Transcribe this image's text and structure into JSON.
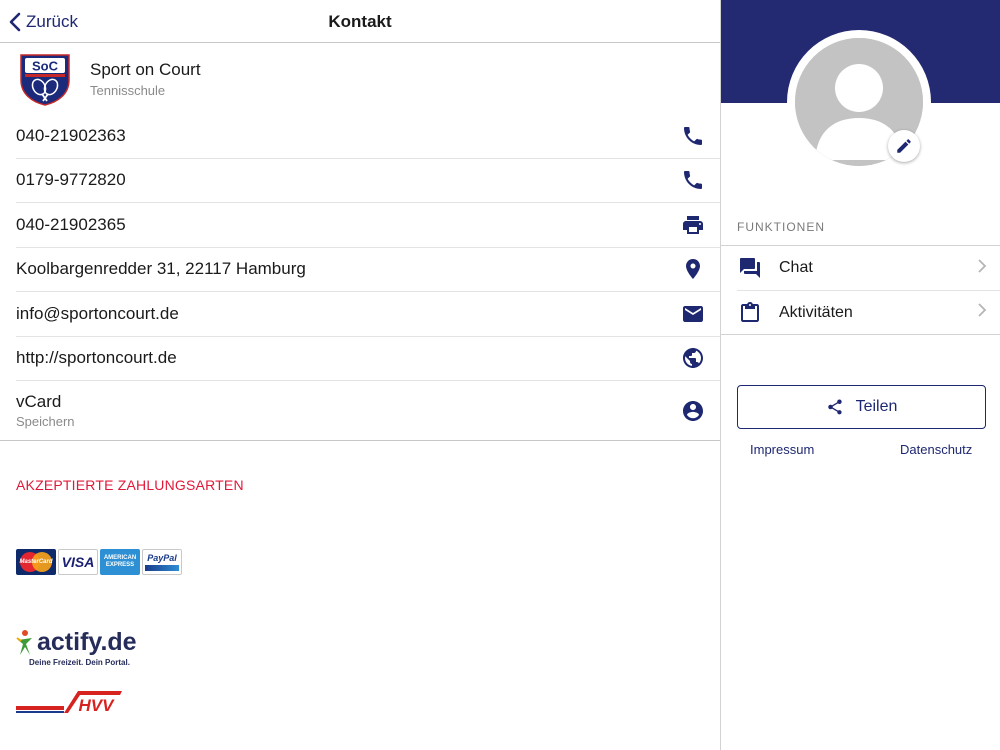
{
  "nav": {
    "back_label": "Zurück",
    "title": "Kontakt"
  },
  "organization": {
    "name": "Sport on Court",
    "subtitle": "Tennisschule",
    "logo_text": "SoC"
  },
  "contacts": [
    {
      "text": "040-21902363",
      "icon": "phone-icon"
    },
    {
      "text": "0179-9772820",
      "icon": "phone-icon"
    },
    {
      "text": "040-21902365",
      "icon": "printer-icon"
    },
    {
      "text": "Koolbargenredder 31, 22117 Hamburg",
      "icon": "location-pin-icon"
    },
    {
      "text": "info@sportoncourt.de",
      "icon": "envelope-icon"
    },
    {
      "text": "http://sportoncourt.de",
      "icon": "globe-icon"
    }
  ],
  "vcard": {
    "label": "vCard",
    "sublabel": "Speichern",
    "icon": "account-circle-icon"
  },
  "payment": {
    "heading": "AKZEPTIERTE ZAHLUNGSARTEN",
    "methods": [
      {
        "name": "MasterCard",
        "label": "MasterCard"
      },
      {
        "name": "Visa",
        "label": "VISA"
      },
      {
        "name": "American Express",
        "label_line1": "AMERICAN",
        "label_line2": "EXPRESS"
      },
      {
        "name": "PayPal",
        "label": "PayPal"
      }
    ]
  },
  "partners": {
    "actify": {
      "name": "actify.de",
      "tagline": "Deine Freizeit. Dein Portal."
    },
    "hvv": {
      "name": "HVV"
    }
  },
  "sidebar": {
    "functions_heading": "FUNKTIONEN",
    "functions": [
      {
        "label": "Chat",
        "icon": "chat-icon"
      },
      {
        "label": "Aktivitäten",
        "icon": "clipboard-icon"
      }
    ],
    "share_label": "Teilen",
    "links": {
      "impressum": "Impressum",
      "datenschutz": "Datenschutz"
    }
  },
  "colors": {
    "primary": "#1e2870",
    "header_band": "#242a72",
    "accent_red": "#e0193a",
    "avatar_gray": "#c3c3c3"
  }
}
